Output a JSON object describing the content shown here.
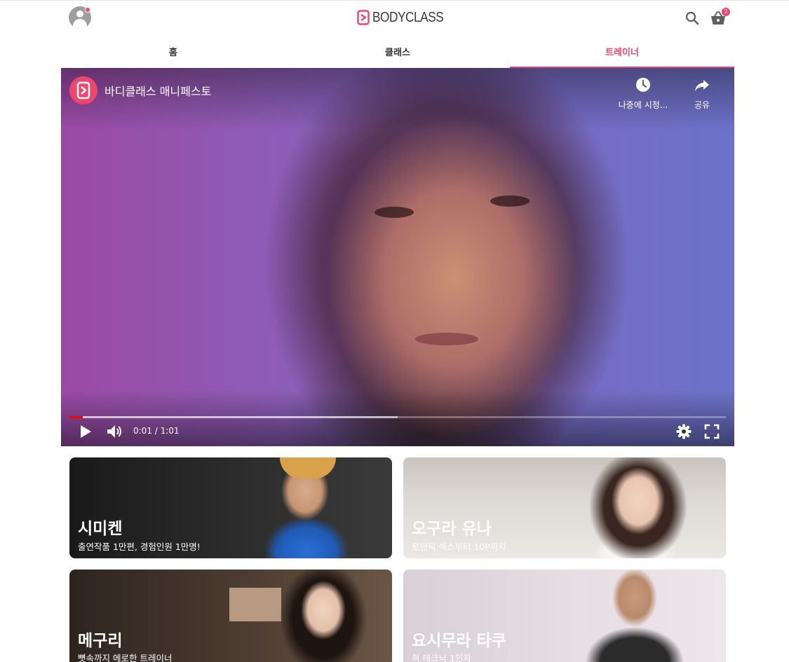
{
  "app": {
    "logo_text": "BODYCLASS",
    "brand_color": "#f0466e"
  },
  "header": {
    "avatar_icon": "account-circle-icon",
    "search_icon": "search-icon",
    "cart_icon": "shopping-basket-icon",
    "cart_count": "2"
  },
  "tabs": [
    {
      "label": "홈",
      "active": false
    },
    {
      "label": "클래스",
      "active": false
    },
    {
      "label": "트레이너",
      "active": true
    }
  ],
  "video": {
    "title": "바디클래스 매니페스토",
    "watch_later_label": "나중에 시청...",
    "share_label": "공유",
    "time": "0:01 / 1:01",
    "progress_played": 0.02,
    "progress_buffered": 0.5
  },
  "trainers": [
    {
      "name": "시미켄",
      "subtitle": "출연작품 1만편, 경험인원 1만명!"
    },
    {
      "name": "오구라 유나",
      "subtitle": "로맨틱 섹스부터 10P까지"
    },
    {
      "name": "메구리",
      "subtitle": "뼛속까지 에로한 트레이너"
    },
    {
      "name": "요시무라 타쿠",
      "subtitle": "혀 테크닉 1인자"
    }
  ]
}
